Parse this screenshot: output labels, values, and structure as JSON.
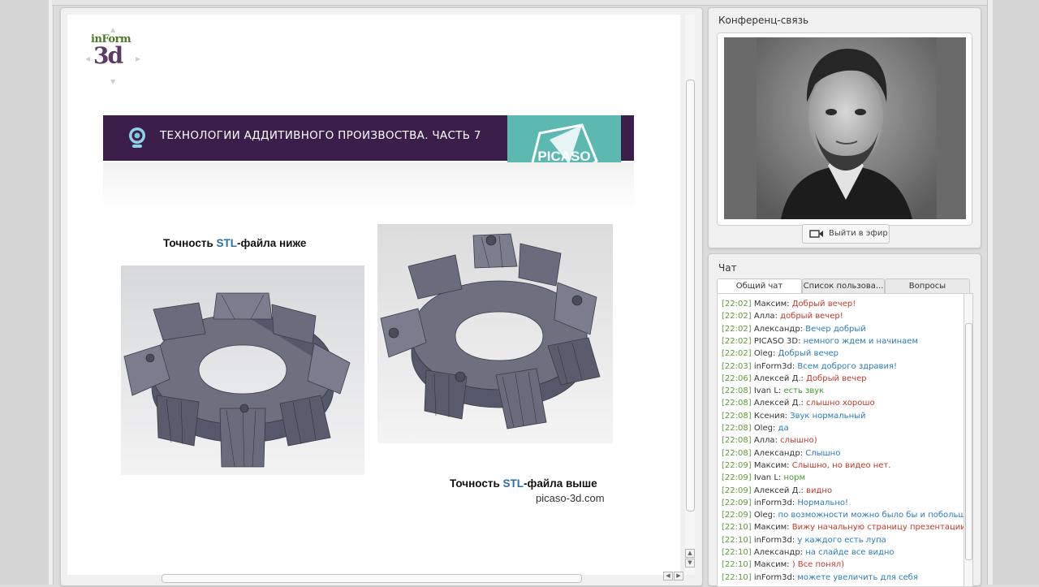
{
  "presentation": {
    "logo": {
      "top": "inForm",
      "big": "3d"
    },
    "banner_title": "ТЕХНОЛОГИИ АДДИТИВНОГО ПРОИЗВОСТВА. ЧАСТЬ 7",
    "brand": "PICASO",
    "caption_low": {
      "pre": "Точность ",
      "hl": "STL",
      "post": "-файла ниже"
    },
    "caption_high": {
      "pre": "Точность ",
      "hl": "STL",
      "post": "-файла выше"
    },
    "site": "picaso-3d.com",
    "colors": {
      "banner": "#3b1f4a",
      "shield": "#5bb9b2",
      "highlight": "#2c6ea7"
    }
  },
  "conference": {
    "title": "Конференц-связь",
    "go_live_label": "Выйти в эфир",
    "icons": [
      "camera-icon"
    ]
  },
  "chat": {
    "title": "Чат",
    "tabs": [
      "Общий чат",
      "Список пользова...",
      "Вопросы"
    ],
    "messages": [
      {
        "time": "[22:02]",
        "user": "Максим:",
        "text": "Добрый вечер!",
        "color": "#c0392b"
      },
      {
        "time": "[22:02]",
        "user": "Алла:",
        "text": "добрый вечер!",
        "color": "#c0392b"
      },
      {
        "time": "[22:02]",
        "user": "Александр:",
        "text": "Вечер добрый",
        "color": "#2b7bb9"
      },
      {
        "time": "[22:02]",
        "user": "PICASO 3D:",
        "text": "немного ждем и начинаем",
        "color": "#2b7bb9"
      },
      {
        "time": "[22:02]",
        "user": "Oleg:",
        "text": "Добрый вечер",
        "color": "#2b7bb9"
      },
      {
        "time": "[22:03]",
        "user": "inForm3d:",
        "text": "Всем доброго здравия!",
        "color": "#2b7bb9"
      },
      {
        "time": "[22:06]",
        "user": "Алексей Д.:",
        "text": "Добрый вечер",
        "color": "#c0392b"
      },
      {
        "time": "[22:08]",
        "user": "Ivan L:",
        "text": "есть звук",
        "color": "#3f9a2f"
      },
      {
        "time": "[22:08]",
        "user": "Алексей Д.:",
        "text": "слышно хорошо",
        "color": "#c0392b"
      },
      {
        "time": "[22:08]",
        "user": "Ксения:",
        "text": "Звук нормальный",
        "color": "#2b7bb9"
      },
      {
        "time": "[22:08]",
        "user": "Oleg:",
        "text": "да",
        "color": "#2b7bb9"
      },
      {
        "time": "[22:08]",
        "user": "Алла:",
        "text": "слышно)",
        "color": "#c0392b"
      },
      {
        "time": "[22:08]",
        "user": "Александр:",
        "text": "Слышно",
        "color": "#2b7bb9"
      },
      {
        "time": "[22:09]",
        "user": "Максим:",
        "text": "Слышно, но видео нет.",
        "color": "#c0392b"
      },
      {
        "time": "[22:09]",
        "user": "Ivan L:",
        "text": "норм",
        "color": "#3f9a2f"
      },
      {
        "time": "[22:09]",
        "user": "Алексей Д.:",
        "text": "видно",
        "color": "#c0392b"
      },
      {
        "time": "[22:09]",
        "user": "inForm3d:",
        "text": "Нормально!",
        "color": "#2b7bb9"
      },
      {
        "time": "[22:09]",
        "user": "Oleg:",
        "text": "по возможности можно было бы и побольше",
        "color": "#2b7bb9"
      },
      {
        "time": "[22:10]",
        "user": "Максим:",
        "text": "Вижу начальную страницу презентации",
        "color": "#c0392b"
      },
      {
        "time": "[22:10]",
        "user": "inForm3d:",
        "text": "у каждого есть лупа",
        "color": "#2b7bb9"
      },
      {
        "time": "[22:10]",
        "user": "Александр:",
        "text": "на слайде все видно",
        "color": "#2b7bb9"
      },
      {
        "time": "[22:10]",
        "user": "Максим:",
        "text": ") Все понял)",
        "color": "#c0392b"
      },
      {
        "time": "[22:10]",
        "user": "inForm3d:",
        "text": "можете увеличить для себя",
        "color": "#2b7bb9"
      }
    ]
  }
}
